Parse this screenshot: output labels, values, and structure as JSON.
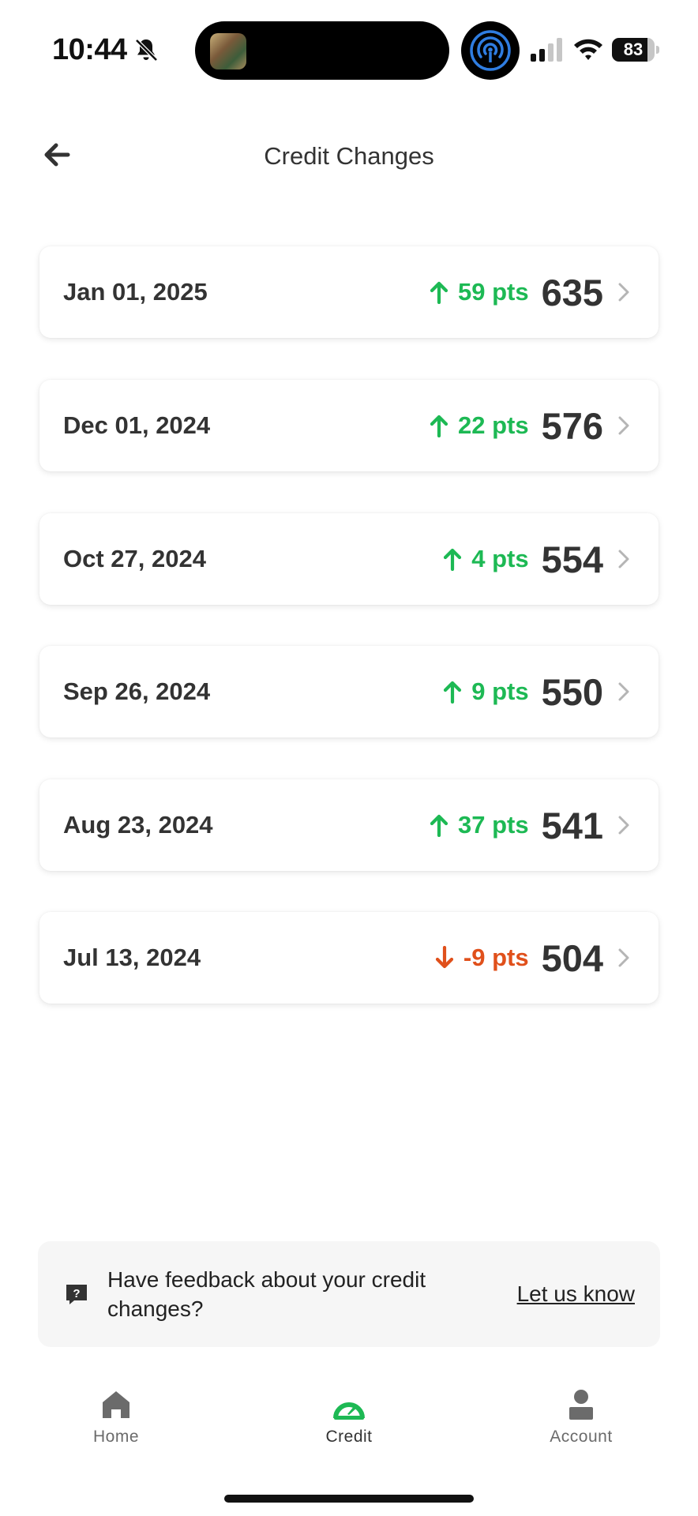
{
  "status_bar": {
    "time": "10:44",
    "battery": "83",
    "battery_level": 0.83,
    "icons": [
      "bell-muted-icon",
      "now-playing-thumbnail",
      "airdrop-icon",
      "signal-icon",
      "wifi-icon",
      "battery-icon"
    ]
  },
  "header": {
    "title": "Credit Changes",
    "back_icon": "arrow-left-icon"
  },
  "colors": {
    "positive": "#1db954",
    "negative": "#e0501b",
    "text": "#333333",
    "active_tab": "#1db954",
    "inactive_tab": "#6b6b6b"
  },
  "changes": [
    {
      "date": "Jan 01, 2025",
      "direction": "up",
      "delta": "59 pts",
      "score": "635"
    },
    {
      "date": "Dec 01, 2024",
      "direction": "up",
      "delta": "22 pts",
      "score": "576"
    },
    {
      "date": "Oct 27, 2024",
      "direction": "up",
      "delta": "4 pts",
      "score": "554"
    },
    {
      "date": "Sep 26, 2024",
      "direction": "up",
      "delta": "9 pts",
      "score": "550"
    },
    {
      "date": "Aug 23, 2024",
      "direction": "up",
      "delta": "37 pts",
      "score": "541"
    },
    {
      "date": "Jul 13, 2024",
      "direction": "down",
      "delta": "-9 pts",
      "score": "504"
    }
  ],
  "feedback": {
    "text": "Have feedback about your credit changes?",
    "link": "Let us know",
    "icon": "question-bubble-icon"
  },
  "tabs": [
    {
      "label": "Home",
      "icon": "home-icon",
      "active": false
    },
    {
      "label": "Credit",
      "icon": "gauge-icon",
      "active": true
    },
    {
      "label": "Account",
      "icon": "person-icon",
      "active": false
    }
  ]
}
